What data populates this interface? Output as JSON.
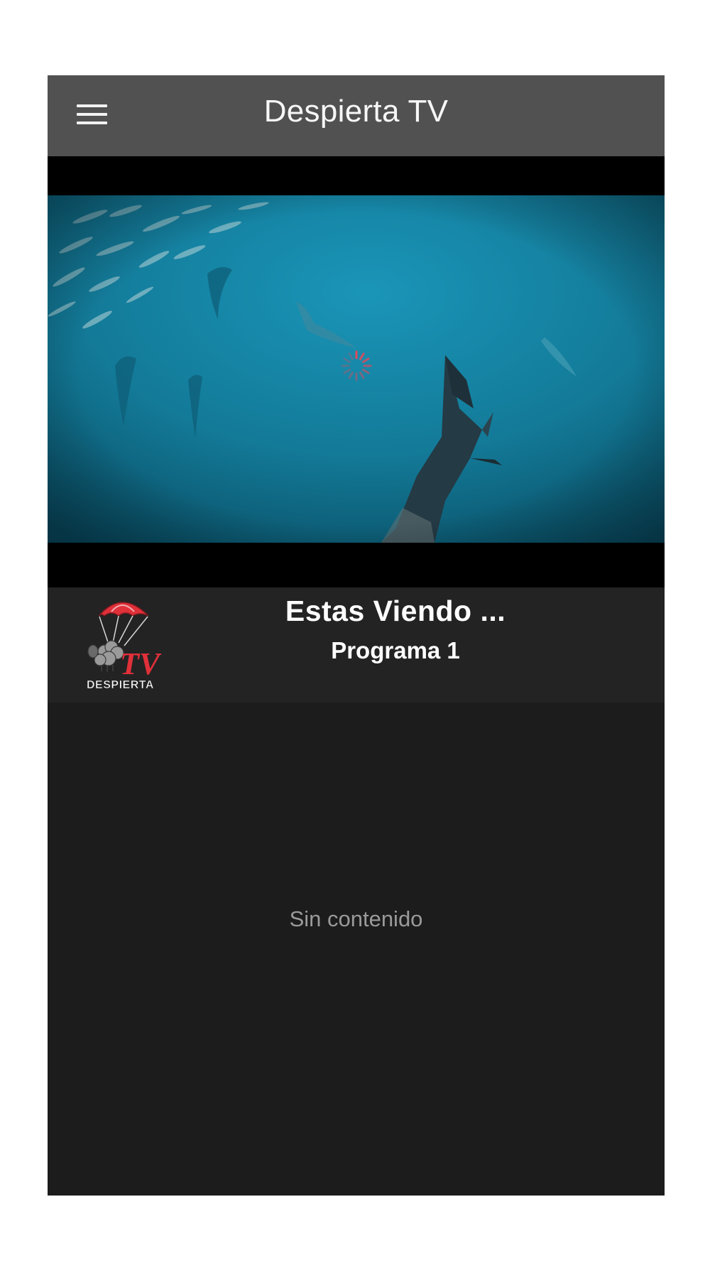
{
  "header": {
    "title": "Despierta TV",
    "menu_icon": "hamburger-menu-icon"
  },
  "player": {
    "state": "loading",
    "spinner_icon": "loading-spinner-icon"
  },
  "now_playing": {
    "heading": "Estas Viendo ...",
    "program": "Programa 1",
    "logo_text": "DESPIERTA",
    "logo_tv": "TV"
  },
  "content": {
    "empty_message": "Sin contenido"
  },
  "colors": {
    "appbar": "#515151",
    "background": "#1c1c1c",
    "now_row": "#232323",
    "accent_red": "#e0303a"
  }
}
